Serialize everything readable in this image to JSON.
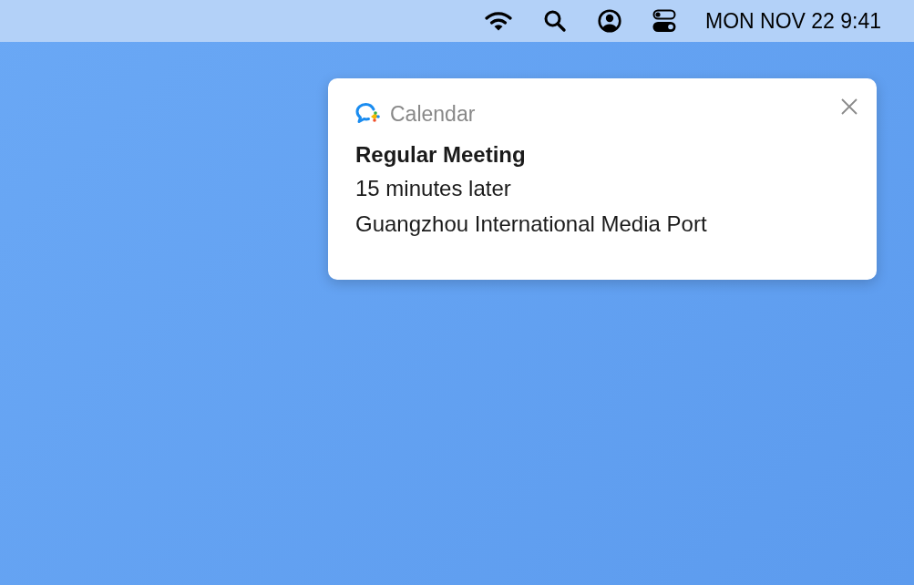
{
  "menu_bar": {
    "clock": "MON NOV 22 9:41"
  },
  "notification": {
    "app_name": "Calendar",
    "title": "Regular Meeting",
    "time": "15 minutes later",
    "location": "Guangzhou International Media Port"
  }
}
